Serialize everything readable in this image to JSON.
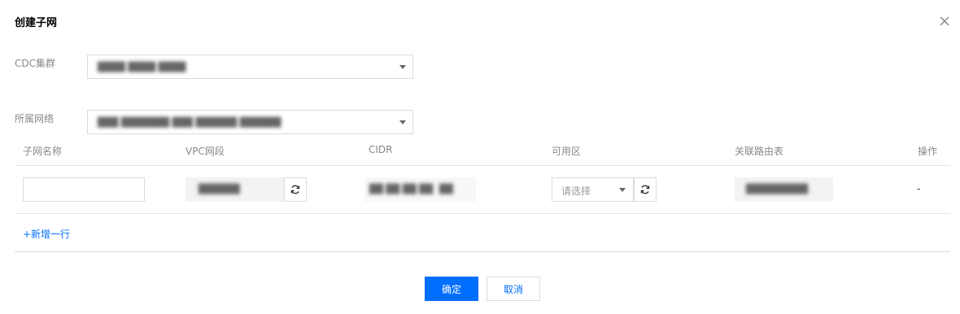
{
  "dialog": {
    "title": "创建子网",
    "close_icon": "close-icon"
  },
  "form": {
    "cdc_label": "CDC集群",
    "cdc_value": "████ ████ ████",
    "vpc_label": "所属网络",
    "vpc_value": "███ ███████ ███ ██████ ██████"
  },
  "table": {
    "headers": [
      "子网名称",
      "VPC网段",
      "CIDR",
      "可用区",
      "关联路由表",
      "操作"
    ],
    "row": {
      "subnet_name": "",
      "vpc_segment": "██████",
      "cidr": "██ ██ ██ ██",
      "cidr_mask": "██",
      "zone_placeholder": "请选择",
      "route_table": "█████████",
      "operation": "-"
    }
  },
  "add_row_label": "+新增一行",
  "footer": {
    "confirm_label": "确定",
    "cancel_label": "取消"
  },
  "colors": {
    "primary": "#006eff",
    "label": "#888888",
    "border": "#dcdcdc"
  }
}
